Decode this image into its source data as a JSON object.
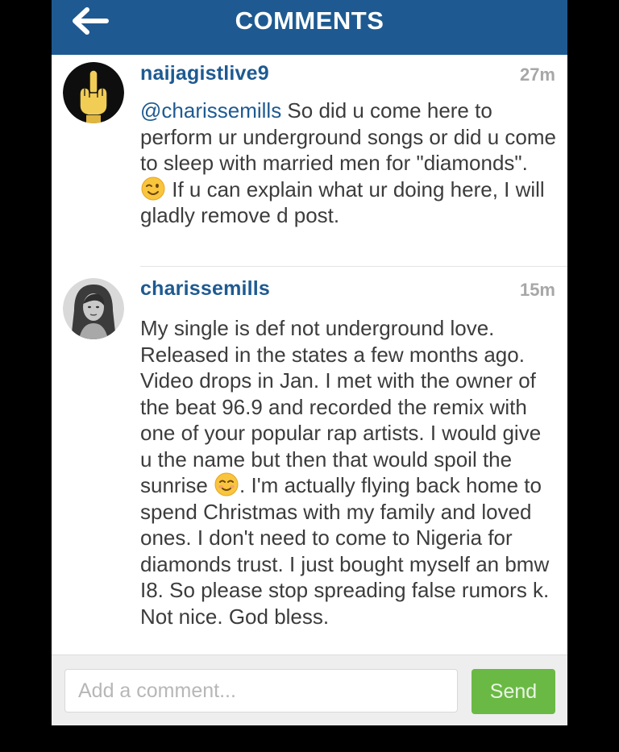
{
  "header": {
    "title": "COMMENTS",
    "back_icon": "arrow-left-icon"
  },
  "comments": [
    {
      "username": "naijagistlive9",
      "time": "27m",
      "mention": "@charissemills",
      "text_part1": " So did u come here to perform ur underground songs or did u come to sleep with married men for \"diamonds\". ",
      "emoji": "winking-face-emoji",
      "text_part2": " If u can explain what ur doing here, I will gladly remove d post."
    },
    {
      "username": "charissemills",
      "time": "15m",
      "text_part1": "My single is def not underground love. Released in the states a few months ago. Video drops in Jan. I met with the owner of the beat 96.9 and recorded the remix with one of your popular rap artists. I would give u the name but then that would spoil the sunrise ",
      "emoji": "smiling-face-emoji",
      "text_part2": ". I'm actually flying back home to spend Christmas with my family and loved ones. I don't need to come to Nigeria for diamonds trust. I just bought myself an bmw I8. So please stop spreading false rumors k. Not nice. God bless."
    }
  ],
  "footer": {
    "input_placeholder": "Add a comment...",
    "send_label": "Send"
  },
  "colors": {
    "header_bg": "#1e5a91",
    "username": "#1e5a91",
    "send_button": "#6ab944"
  }
}
